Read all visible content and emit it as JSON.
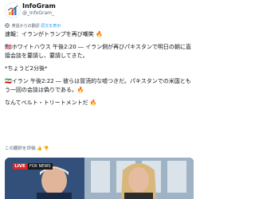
{
  "account": {
    "display_name": "InfoGram",
    "handle": "@_InfoGram_"
  },
  "translation": {
    "note": "英語からの翻訳",
    "link": "原文を表示"
  },
  "tweet": {
    "paragraphs": [
      "速報：イランがトランプを再び嘲笑 🔥",
      "🇺🇸ホワイトハウス 午後2:20 ― イラン側が再びパキスタンで明日の朝に直接会談を要請し、要請してきた。",
      "*ちょうど2分後*",
      "🇮🇷イラン 午後2:22 ― 彼らは冒涜的な嘘つきだ。パキスタンでの米国ともう一回の会談は偽りである。🔥",
      "なんてベルト・トリートメントだ 🔥"
    ]
  },
  "rate_translation": "この翻訳を評価 👍 👎",
  "media": {
    "badge": "LIVE",
    "tag": "FOX NEWS",
    "colors": {
      "sky": "#33507a",
      "window": "#c9d5de",
      "live": "#d6282a"
    }
  }
}
